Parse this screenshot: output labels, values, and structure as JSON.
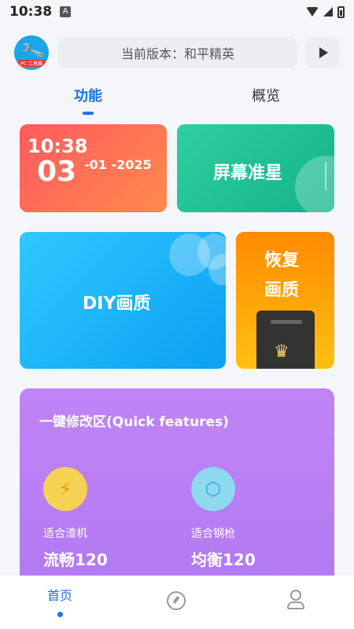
{
  "status_bar": {
    "time": "10:38",
    "notification_icon": "A"
  },
  "header": {
    "logo_tag": "PC 工具箱",
    "version_text": "当前版本：和平精英"
  },
  "tabs": [
    {
      "label": "功能",
      "active": true
    },
    {
      "label": "概览",
      "active": false
    }
  ],
  "cards": {
    "clock": {
      "time": "10:38",
      "day": "03",
      "rest": "-01 -2025"
    },
    "crosshair": {
      "label": "屏幕准星"
    },
    "diy": {
      "label": "DIY画质"
    },
    "restore": {
      "line1": "恢复",
      "line2": "画质"
    }
  },
  "quick": {
    "title": "一键修改区(Quick features)",
    "features": [
      {
        "sub": "适合渣机",
        "main": "流畅120",
        "icon": "lightning-shield-icon"
      },
      {
        "sub": "适合钢枪",
        "main": "均衡120",
        "icon": "hexagon-gem-icon"
      }
    ]
  },
  "bottom_nav": {
    "home_label": "首页",
    "items": [
      "home",
      "compass-icon",
      "user-icon"
    ]
  },
  "colors": {
    "accent": "#1a73e8",
    "clock_card": "#ff6a55",
    "crosshair_card": "#22c196",
    "diy_card": "#1eb4fa",
    "restore_card": "#ffa50a",
    "quick_card": "#bb80f4"
  }
}
